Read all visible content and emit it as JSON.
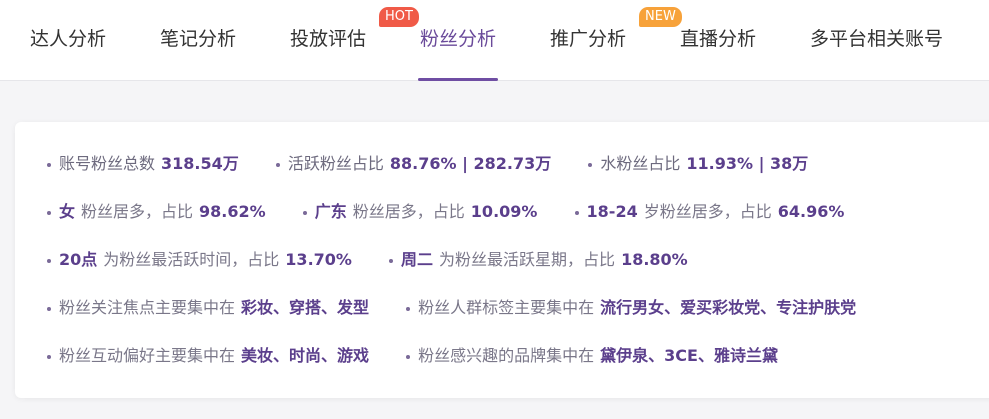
{
  "tabs": [
    {
      "label": "达人分析",
      "active": false
    },
    {
      "label": "笔记分析",
      "active": false
    },
    {
      "label": "投放评估",
      "active": false,
      "badge": "HOT"
    },
    {
      "label": "粉丝分析",
      "active": true
    },
    {
      "label": "推广分析",
      "active": false,
      "badge": "NEW"
    },
    {
      "label": "直播分析",
      "active": false
    },
    {
      "label": "多平台相关账号",
      "active": false
    }
  ],
  "summary": {
    "row1": {
      "total_label": "账号粉丝总数",
      "total_value": "318.54万",
      "active_label": "活跃粉丝占比",
      "active_value": "88.76% | 282.73万",
      "water_label": "水粉丝占比",
      "water_value": "11.93% | 38万"
    },
    "row2": {
      "gender_value": "女",
      "gender_text": "粉丝居多，占比",
      "gender_pct": "98.62%",
      "region_value": "广东",
      "region_text": "粉丝居多，占比",
      "region_pct": "10.09%",
      "age_value": "18-24",
      "age_text": "岁粉丝居多，占比",
      "age_pct": "64.96%"
    },
    "row3": {
      "hour_value": "20点",
      "hour_text": "为粉丝最活跃时间，占比",
      "hour_pct": "13.70%",
      "day_value": "周二",
      "day_text": "为粉丝最活跃星期，占比",
      "day_pct": "18.80%"
    },
    "row4": {
      "focus_text": "粉丝关注焦点主要集中在",
      "focus_value": "彩妆、穿搭、发型",
      "tag_text": "粉丝人群标签主要集中在",
      "tag_value": "流行男女、爱买彩妆党、专注护肤党"
    },
    "row5": {
      "pref_text": "粉丝互动偏好主要集中在",
      "pref_value": "美妆、时尚、游戏",
      "brand_text": "粉丝感兴趣的品牌集中在",
      "brand_value": "黛伊泉、3CE、雅诗兰黛"
    }
  },
  "colors": {
    "accent": "#6f4ea3",
    "hot_badge": "#f05a47",
    "new_badge": "#f7a23a"
  }
}
